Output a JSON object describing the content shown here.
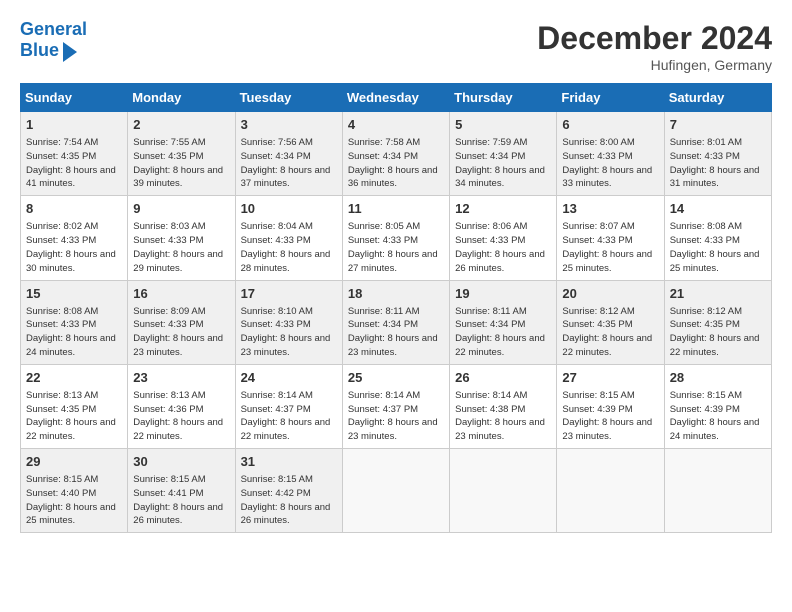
{
  "header": {
    "logo_line1": "General",
    "logo_line2": "Blue",
    "month_title": "December 2024",
    "location": "Hufingen, Germany"
  },
  "days_of_week": [
    "Sunday",
    "Monday",
    "Tuesday",
    "Wednesday",
    "Thursday",
    "Friday",
    "Saturday"
  ],
  "weeks": [
    [
      {
        "day": "1",
        "sunrise": "7:54 AM",
        "sunset": "4:35 PM",
        "daylight": "8 hours and 41 minutes."
      },
      {
        "day": "2",
        "sunrise": "7:55 AM",
        "sunset": "4:35 PM",
        "daylight": "8 hours and 39 minutes."
      },
      {
        "day": "3",
        "sunrise": "7:56 AM",
        "sunset": "4:34 PM",
        "daylight": "8 hours and 37 minutes."
      },
      {
        "day": "4",
        "sunrise": "7:58 AM",
        "sunset": "4:34 PM",
        "daylight": "8 hours and 36 minutes."
      },
      {
        "day": "5",
        "sunrise": "7:59 AM",
        "sunset": "4:34 PM",
        "daylight": "8 hours and 34 minutes."
      },
      {
        "day": "6",
        "sunrise": "8:00 AM",
        "sunset": "4:33 PM",
        "daylight": "8 hours and 33 minutes."
      },
      {
        "day": "7",
        "sunrise": "8:01 AM",
        "sunset": "4:33 PM",
        "daylight": "8 hours and 31 minutes."
      }
    ],
    [
      {
        "day": "8",
        "sunrise": "8:02 AM",
        "sunset": "4:33 PM",
        "daylight": "8 hours and 30 minutes."
      },
      {
        "day": "9",
        "sunrise": "8:03 AM",
        "sunset": "4:33 PM",
        "daylight": "8 hours and 29 minutes."
      },
      {
        "day": "10",
        "sunrise": "8:04 AM",
        "sunset": "4:33 PM",
        "daylight": "8 hours and 28 minutes."
      },
      {
        "day": "11",
        "sunrise": "8:05 AM",
        "sunset": "4:33 PM",
        "daylight": "8 hours and 27 minutes."
      },
      {
        "day": "12",
        "sunrise": "8:06 AM",
        "sunset": "4:33 PM",
        "daylight": "8 hours and 26 minutes."
      },
      {
        "day": "13",
        "sunrise": "8:07 AM",
        "sunset": "4:33 PM",
        "daylight": "8 hours and 25 minutes."
      },
      {
        "day": "14",
        "sunrise": "8:08 AM",
        "sunset": "4:33 PM",
        "daylight": "8 hours and 25 minutes."
      }
    ],
    [
      {
        "day": "15",
        "sunrise": "8:08 AM",
        "sunset": "4:33 PM",
        "daylight": "8 hours and 24 minutes."
      },
      {
        "day": "16",
        "sunrise": "8:09 AM",
        "sunset": "4:33 PM",
        "daylight": "8 hours and 23 minutes."
      },
      {
        "day": "17",
        "sunrise": "8:10 AM",
        "sunset": "4:33 PM",
        "daylight": "8 hours and 23 minutes."
      },
      {
        "day": "18",
        "sunrise": "8:11 AM",
        "sunset": "4:34 PM",
        "daylight": "8 hours and 23 minutes."
      },
      {
        "day": "19",
        "sunrise": "8:11 AM",
        "sunset": "4:34 PM",
        "daylight": "8 hours and 22 minutes."
      },
      {
        "day": "20",
        "sunrise": "8:12 AM",
        "sunset": "4:35 PM",
        "daylight": "8 hours and 22 minutes."
      },
      {
        "day": "21",
        "sunrise": "8:12 AM",
        "sunset": "4:35 PM",
        "daylight": "8 hours and 22 minutes."
      }
    ],
    [
      {
        "day": "22",
        "sunrise": "8:13 AM",
        "sunset": "4:35 PM",
        "daylight": "8 hours and 22 minutes."
      },
      {
        "day": "23",
        "sunrise": "8:13 AM",
        "sunset": "4:36 PM",
        "daylight": "8 hours and 22 minutes."
      },
      {
        "day": "24",
        "sunrise": "8:14 AM",
        "sunset": "4:37 PM",
        "daylight": "8 hours and 22 minutes."
      },
      {
        "day": "25",
        "sunrise": "8:14 AM",
        "sunset": "4:37 PM",
        "daylight": "8 hours and 23 minutes."
      },
      {
        "day": "26",
        "sunrise": "8:14 AM",
        "sunset": "4:38 PM",
        "daylight": "8 hours and 23 minutes."
      },
      {
        "day": "27",
        "sunrise": "8:15 AM",
        "sunset": "4:39 PM",
        "daylight": "8 hours and 23 minutes."
      },
      {
        "day": "28",
        "sunrise": "8:15 AM",
        "sunset": "4:39 PM",
        "daylight": "8 hours and 24 minutes."
      }
    ],
    [
      {
        "day": "29",
        "sunrise": "8:15 AM",
        "sunset": "4:40 PM",
        "daylight": "8 hours and 25 minutes."
      },
      {
        "day": "30",
        "sunrise": "8:15 AM",
        "sunset": "4:41 PM",
        "daylight": "8 hours and 26 minutes."
      },
      {
        "day": "31",
        "sunrise": "8:15 AM",
        "sunset": "4:42 PM",
        "daylight": "8 hours and 26 minutes."
      },
      null,
      null,
      null,
      null
    ]
  ]
}
